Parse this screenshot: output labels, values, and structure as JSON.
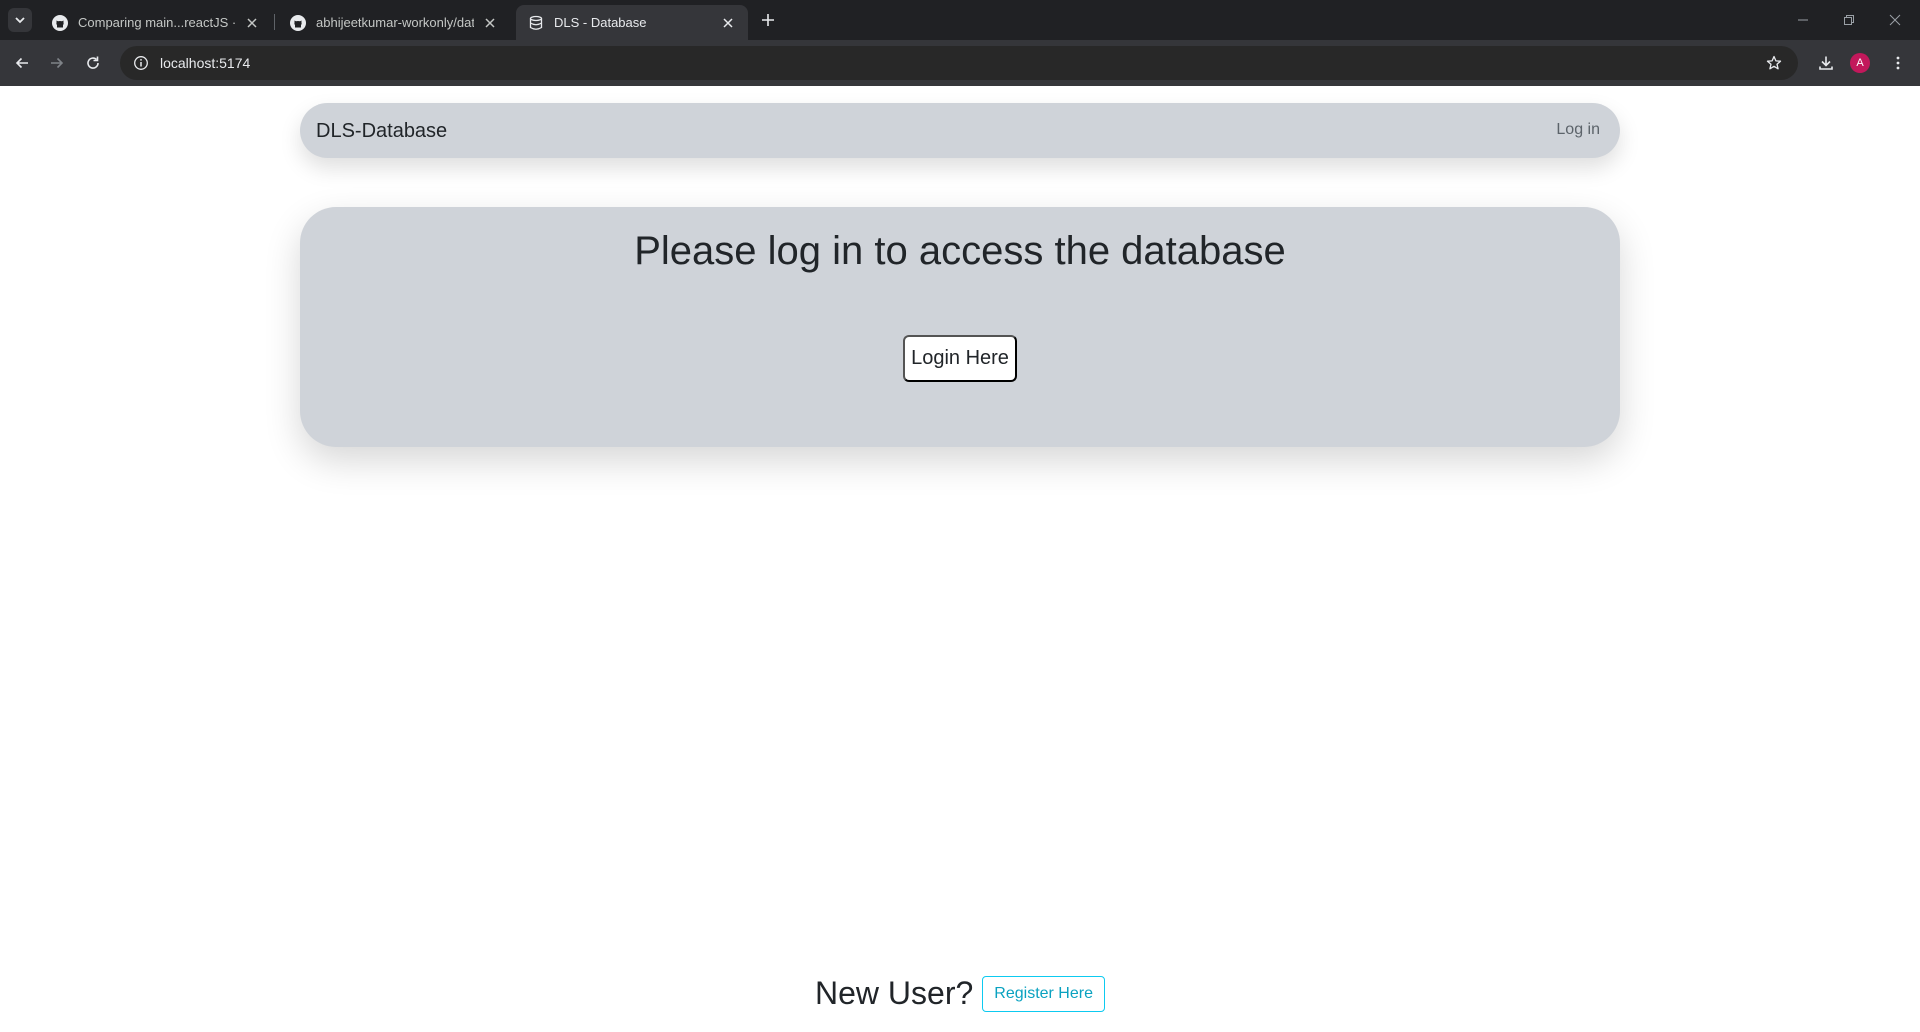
{
  "browser": {
    "tabs": [
      {
        "title": "Comparing main...reactJS · abhi",
        "icon": "github-icon",
        "active": false
      },
      {
        "title": "abhijeetkumar-workonly/datab",
        "icon": "github-icon",
        "active": false
      },
      {
        "title": "DLS - Database",
        "icon": "database-icon",
        "active": true
      }
    ],
    "url": "localhost:5174",
    "profile_initial": "A",
    "profile_color": "#c2185b"
  },
  "navbar": {
    "brand": "DLS-Database",
    "login_link": "Log in"
  },
  "card": {
    "title": "Please log in to access the database",
    "login_button": "Login Here"
  },
  "footer": {
    "question": "New User?",
    "register_button": "Register Here"
  },
  "colors": {
    "panel_bg": "#cfd3d9",
    "text": "#212529",
    "accent_info": "#0dcaf0"
  }
}
